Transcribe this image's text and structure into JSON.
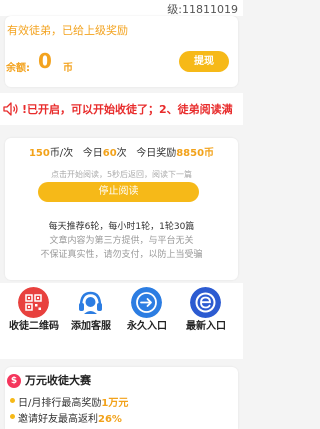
{
  "level": "级:11811019",
  "reward": {
    "invite_note": "有效徒弟，已给上级奖励",
    "balance_label": "余额:",
    "balance_value": "0",
    "balance_unit": "币",
    "withdraw_label": "提现"
  },
  "notice": {
    "icon": "speaker-icon",
    "text": "!已开启，可以开始收徒了；2、徒弟阅读满"
  },
  "reading": {
    "coins_per": "150",
    "per_unit": "币/次",
    "today_label": "今日",
    "today_count": "60",
    "times_unit": "次",
    "today_reward_label": "今日奖励",
    "today_reward": "8850",
    "coin_unit": "币",
    "hint": "点击开始阅读，5秒后返回，阅读下一篇",
    "stop_label": "停止阅读",
    "daily_rule": "每天推荐6轮，每小时1轮，1轮30篇",
    "disclaimer1": "文章内容为第三方提供，与平台无关",
    "disclaimer2": "不保证真实性，请勿支付，以防上当受骗"
  },
  "actions": [
    {
      "label": "收徒二维码",
      "icon": "qrcode-icon",
      "color": "#e8413e"
    },
    {
      "label": "添加客服",
      "icon": "headset-icon",
      "color": "#2c7de2"
    },
    {
      "label": "永久入口",
      "icon": "arrow-right-icon",
      "color": "#2c7de2"
    },
    {
      "label": "最新入口",
      "icon": "letter-e-icon",
      "color": "#2c5bd1"
    }
  ],
  "contest": {
    "icon": "money-icon",
    "icon_glyph": "$",
    "title": "万元收徒大赛",
    "bullet1_prefix": "日/月排行最高奖励",
    "bullet1_amount": "1万元",
    "bullet2_prefix": "邀请好友最高返利",
    "bullet2_amount": "26%"
  },
  "colors": {
    "accent": "#f6b918",
    "highlight": "#f2a21a",
    "notice_red": "#e82c2c"
  }
}
